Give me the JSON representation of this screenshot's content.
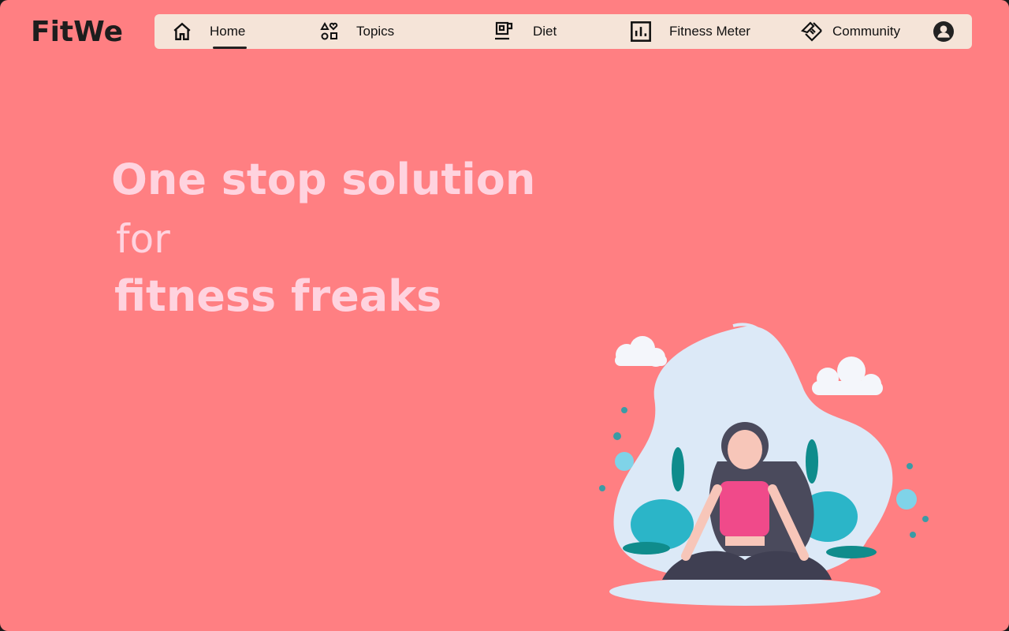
{
  "brand": {
    "logo": "FitWe"
  },
  "nav": {
    "items": [
      {
        "label": "Home",
        "icon": "home-icon",
        "active": true
      },
      {
        "label": "Topics",
        "icon": "shapes-icon"
      },
      {
        "label": "Diet",
        "icon": "mug-icon"
      },
      {
        "label": "Fitness Meter",
        "icon": "bar-chart-icon"
      },
      {
        "label": "Community",
        "icon": "handshake-icon"
      }
    ],
    "profile_icon": "account-circle-icon"
  },
  "hero": {
    "line1": "One stop solution",
    "line2": "for",
    "line3": "fitness freaks"
  },
  "colors": {
    "background": "#FF7F82",
    "nav": "#F5E4D8",
    "hero_text": "#FFD3DF"
  }
}
